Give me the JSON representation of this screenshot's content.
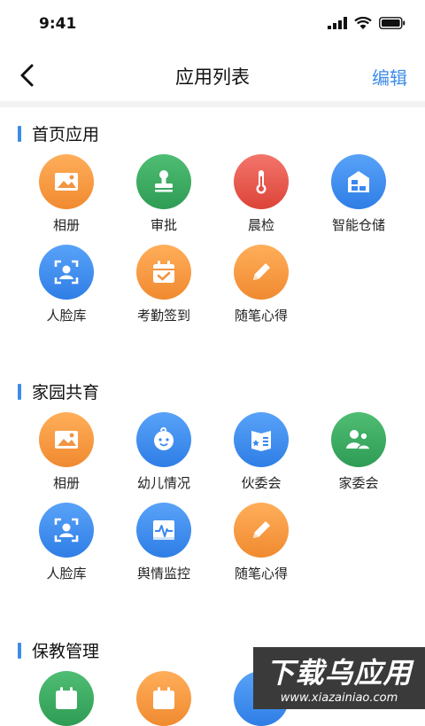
{
  "status": {
    "time": "9:41"
  },
  "nav": {
    "title": "应用列表",
    "edit": "编辑"
  },
  "sections": [
    {
      "title": "首页应用",
      "items": [
        {
          "label": "相册",
          "icon": "photo-icon",
          "color": "orange"
        },
        {
          "label": "审批",
          "icon": "stamp-icon",
          "color": "green"
        },
        {
          "label": "晨检",
          "icon": "thermometer-icon",
          "color": "red"
        },
        {
          "label": "智能仓储",
          "icon": "warehouse-icon",
          "color": "blue"
        },
        {
          "label": "人脸库",
          "icon": "face-scan-icon",
          "color": "blue"
        },
        {
          "label": "考勤签到",
          "icon": "calendar-check-icon",
          "color": "orange"
        },
        {
          "label": "随笔心得",
          "icon": "pencil-icon",
          "color": "orange"
        }
      ]
    },
    {
      "title": "家园共育",
      "items": [
        {
          "label": "相册",
          "icon": "photo-icon",
          "color": "orange"
        },
        {
          "label": "幼儿情况",
          "icon": "baby-face-icon",
          "color": "blue"
        },
        {
          "label": "伙委会",
          "icon": "menu-book-icon",
          "color": "blue"
        },
        {
          "label": "家委会",
          "icon": "family-icon",
          "color": "green"
        },
        {
          "label": "人脸库",
          "icon": "face-scan-icon",
          "color": "blue"
        },
        {
          "label": "舆情监控",
          "icon": "monitor-pulse-icon",
          "color": "blue"
        },
        {
          "label": "随笔心得",
          "icon": "pencil-icon",
          "color": "orange"
        }
      ]
    },
    {
      "title": "保教管理",
      "items": [
        {
          "label": "",
          "icon": "calendar-check-icon",
          "color": "green"
        },
        {
          "label": "",
          "icon": "calendar-check-icon",
          "color": "orange"
        },
        {
          "label": "",
          "icon": "app-icon",
          "color": "blue"
        }
      ]
    }
  ],
  "watermark": {
    "main": "下载乌应用",
    "sub": "www.xiazainiao.com"
  }
}
